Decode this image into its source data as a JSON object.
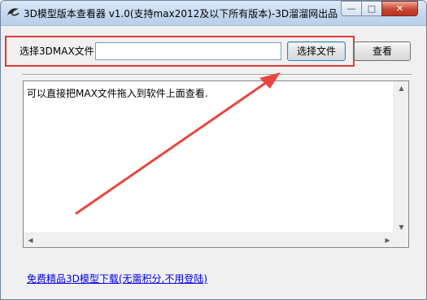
{
  "window": {
    "title": "3D模型版本查看器 v1.0(支持max2012及以下所有版本)-3D溜溜网出品",
    "min_glyph": "—",
    "max_glyph": "□",
    "close_glyph": "✕"
  },
  "file_select": {
    "label": "选择3DMAX文件:",
    "value": "",
    "placeholder": "",
    "choose_button": "选择文件",
    "view_button": "查看"
  },
  "output": {
    "text": "可以直接把MAX文件拖入到软件上面查看."
  },
  "footer": {
    "link_text": "免费精品3D模型下载(无需积分,不用登陆)"
  },
  "colors": {
    "highlight": "#e0393e",
    "link": "#0000ee",
    "close_button": "#c7462f"
  },
  "icons": [
    "app-logo-icon",
    "minimize-icon",
    "maximize-icon",
    "close-icon",
    "scroll-up-icon",
    "scroll-down-icon",
    "scroll-left-icon",
    "scroll-right-icon"
  ]
}
